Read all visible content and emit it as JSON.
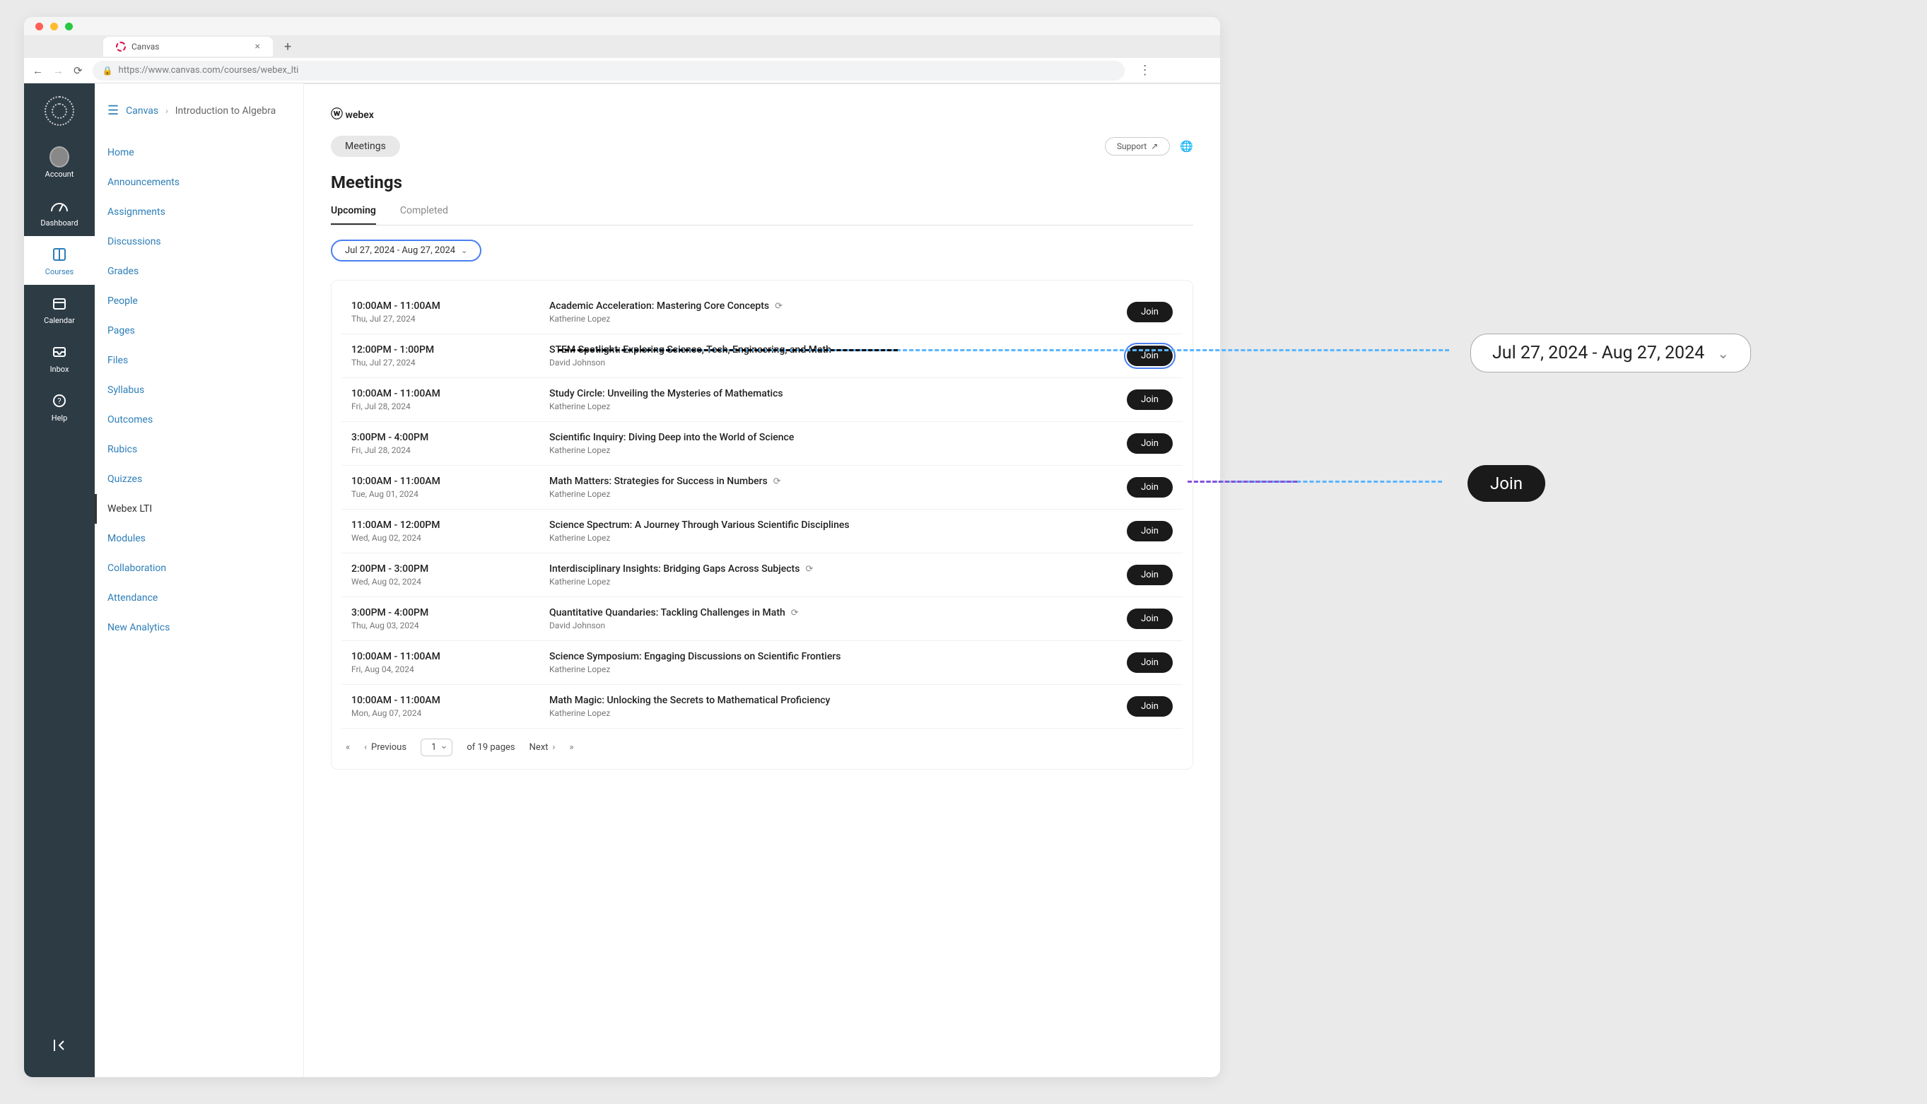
{
  "browser": {
    "tab_title": "Canvas",
    "url": "https://www.canvas.com/courses/webex_lti"
  },
  "breadcrumb": {
    "link": "Canvas",
    "current": "Introduction to Algebra"
  },
  "sidebar": {
    "account": "Account",
    "dashboard": "Dashboard",
    "courses": "Courses",
    "calendar": "Calendar",
    "inbox": "Inbox",
    "help": "Help"
  },
  "cnav": [
    "Home",
    "Announcements",
    "Assignments",
    "Discussions",
    "Grades",
    "People",
    "Pages",
    "Files",
    "Syllabus",
    "Outcomes",
    "Rubics",
    "Quizzes",
    "Webex LTI",
    "Modules",
    "Collaboration",
    "Attendance",
    "New Analytics"
  ],
  "cnav_active": "Webex LTI",
  "webex": {
    "brand": "webex",
    "meetings_chip": "Meetings",
    "support": "Support"
  },
  "page_title": "Meetings",
  "tabs": {
    "upcoming": "Upcoming",
    "completed": "Completed"
  },
  "date_range": "Jul 27, 2024 - Aug 27, 2024",
  "meetings": [
    {
      "time": "10:00AM - 11:00AM",
      "date": "Thu, Jul 27, 2024",
      "title": "Academic Acceleration: Mastering Core Concepts",
      "host": "Katherine Lopez",
      "recurring": true,
      "join": "Join",
      "hl": false
    },
    {
      "time": "12:00PM - 1:00PM",
      "date": "Thu, Jul 27, 2024",
      "title": "STEM Spotlight: Exploring Science, Tech, Engineering, and Math",
      "host": "David Johnson",
      "recurring": false,
      "join": "Join",
      "hl": true
    },
    {
      "time": "10:00AM - 11:00AM",
      "date": "Fri, Jul 28, 2024",
      "title": "Study Circle: Unveiling the Mysteries of Mathematics",
      "host": "Katherine Lopez",
      "recurring": false,
      "join": "Join",
      "hl": false
    },
    {
      "time": "3:00PM - 4:00PM",
      "date": "Fri, Jul 28, 2024",
      "title": "Scientific Inquiry: Diving Deep into the World of Science",
      "host": "Katherine Lopez",
      "recurring": false,
      "join": "Join",
      "hl": false
    },
    {
      "time": "10:00AM - 11:00AM",
      "date": "Tue, Aug 01, 2024",
      "title": "Math Matters: Strategies for Success in Numbers",
      "host": "Katherine Lopez",
      "recurring": true,
      "join": "Join",
      "hl": false
    },
    {
      "time": "11:00AM - 12:00PM",
      "date": "Wed, Aug 02, 2024",
      "title": "Science Spectrum: A Journey Through Various Scientific Disciplines",
      "host": "Katherine Lopez",
      "recurring": false,
      "join": "Join",
      "hl": false
    },
    {
      "time": "2:00PM - 3:00PM",
      "date": "Wed, Aug 02, 2024",
      "title": "Interdisciplinary Insights: Bridging Gaps Across Subjects",
      "host": "Katherine Lopez",
      "recurring": true,
      "join": "Join",
      "hl": false
    },
    {
      "time": "3:00PM - 4:00PM",
      "date": "Thu, Aug 03, 2024",
      "title": "Quantitative Quandaries: Tackling Challenges in Math",
      "host": "David Johnson",
      "recurring": true,
      "join": "Join",
      "hl": false
    },
    {
      "time": "10:00AM - 11:00AM",
      "date": "Fri, Aug 04, 2024",
      "title": "Science Symposium: Engaging Discussions on Scientific Frontiers",
      "host": "Katherine Lopez",
      "recurring": false,
      "join": "Join",
      "hl": false
    },
    {
      "time": "10:00AM - 11:00AM",
      "date": "Mon, Aug 07, 2024",
      "title": "Math Magic: Unlocking the Secrets to Mathematical Proficiency",
      "host": "Katherine Lopez",
      "recurring": false,
      "join": "Join",
      "hl": false
    }
  ],
  "pager": {
    "previous": "Previous",
    "page": "1",
    "of": "of 19 pages",
    "next": "Next"
  },
  "callouts": {
    "date": "Jul 27, 2024 - Aug 27, 2024",
    "join": "Join"
  }
}
